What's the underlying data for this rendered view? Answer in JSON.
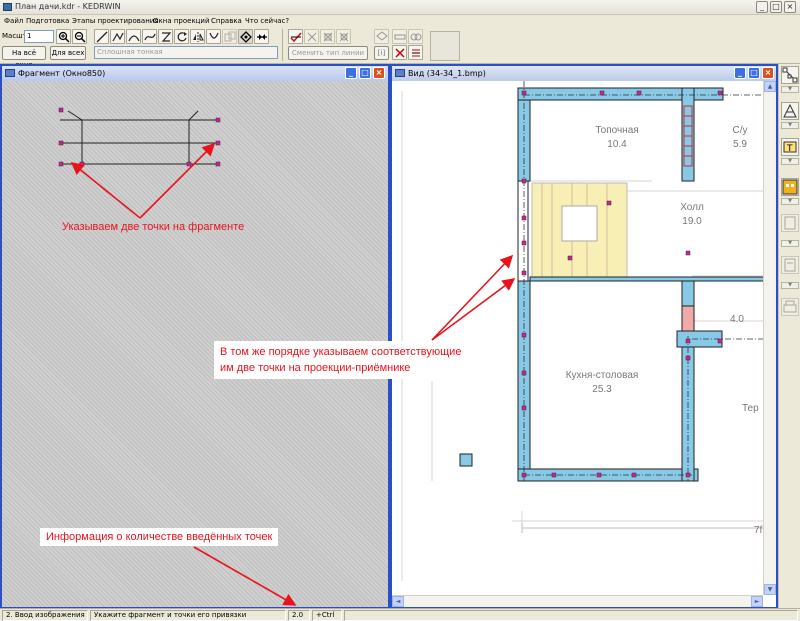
{
  "app": {
    "title": "План дачи.kdr - KEDRWIN"
  },
  "menu": [
    "Файл",
    "Подготовка",
    "Этапы проектирования",
    "Окна проекций",
    "Справка",
    "Что сейчас?"
  ],
  "toolbar": {
    "scale_label": "Масшт",
    "scale_value": "1",
    "fit_all_window": "На всё окно",
    "for_all": "Для всех",
    "line_type_value": "Сплошная тонкая",
    "change_line_type": "Сменить тип линии",
    "code_label": "[ⅰ]"
  },
  "windows": {
    "fragment": {
      "title": "Фрагмент (Окно850)"
    },
    "view": {
      "title": "Вид (34-34_1.bmp)"
    }
  },
  "plan": {
    "rooms": [
      {
        "name": "Топочная",
        "area": "10.4"
      },
      {
        "name": "С/у",
        "area": "5.9"
      },
      {
        "name": "Холл",
        "area": "19.0"
      },
      {
        "name": "Кухня-столовая",
        "area": "25.3"
      },
      {
        "name": "",
        "area": "4.0"
      },
      {
        "name": "Тер",
        "area": ""
      }
    ],
    "dim_label": "7f"
  },
  "annotations": {
    "fragment_points": "Указываем две точки на фрагменте",
    "projection_points_line1": "В том же порядке указываем соответствующие",
    "projection_points_line2": "им две точки на проекции-приёмнике",
    "points_count_info": "Информация о количестве введённых точек"
  },
  "status": {
    "stage": "2. Ввод изображения",
    "hint": "Укажите фрагмент и точки его привязки",
    "points_count": "2.0",
    "modifier": "+Ctrl"
  },
  "colors": {
    "annotation_red": "#e8141c",
    "wall_fill": "#87c9e6",
    "stairs_fill": "#f8efb4",
    "window_border": "#2a50c8",
    "point_marker": "#d0209a"
  }
}
